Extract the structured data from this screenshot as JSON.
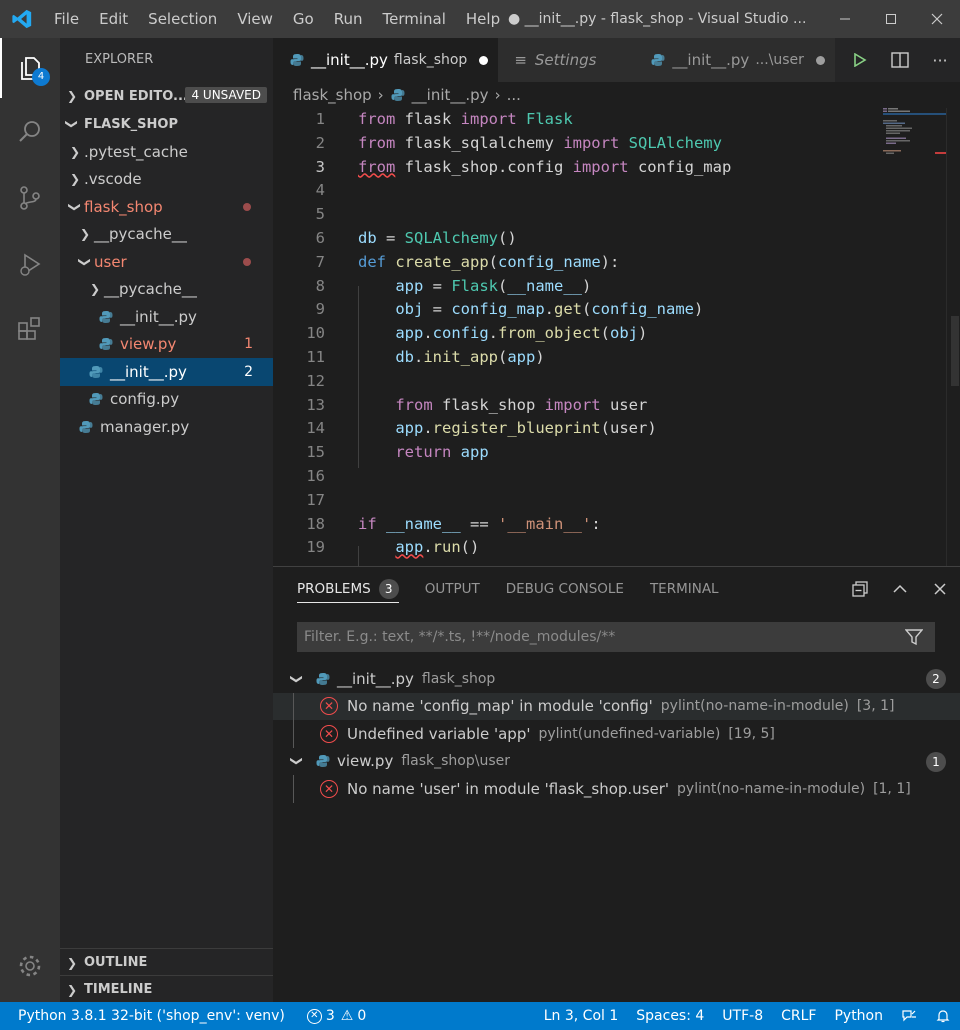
{
  "titlebar": {
    "menu": [
      "File",
      "Edit",
      "Selection",
      "View",
      "Go",
      "Run",
      "Terminal",
      "Help"
    ],
    "window_title": "● __init__.py - flask_shop - Visual Studio ..."
  },
  "activity": {
    "explorer_badge": "4"
  },
  "sidebar": {
    "title": "EXPLORER",
    "open_editors": "OPEN EDITO...",
    "unsaved": "4 UNSAVED",
    "root": "FLASK_SHOP",
    "items": [
      {
        "label": ".pytest_cache"
      },
      {
        "label": ".vscode"
      },
      {
        "label": "flask_shop"
      },
      {
        "label": "__pycache__"
      },
      {
        "label": "user"
      },
      {
        "label": "__pycache__"
      },
      {
        "label": "__init__.py"
      },
      {
        "label": "view.py",
        "count": "1"
      },
      {
        "label": "__init__.py",
        "count": "2"
      },
      {
        "label": "config.py"
      },
      {
        "label": "manager.py"
      }
    ],
    "outline": "OUTLINE",
    "timeline": "TIMELINE"
  },
  "tabs": [
    {
      "name": "__init__.py",
      "desc": "flask_shop"
    },
    {
      "name": "Settings"
    },
    {
      "name": "__init__.py",
      "desc": "...\\user"
    }
  ],
  "breadcrumb": [
    "flask_shop",
    "__init__.py",
    "..."
  ],
  "panel": {
    "tabs": [
      "PROBLEMS",
      "OUTPUT",
      "DEBUG CONSOLE",
      "TERMINAL"
    ],
    "problems_count": "3",
    "filter_placeholder": "Filter. E.g.: text, **/*.ts, !**/node_modules/**",
    "groups": [
      {
        "file": "__init__.py",
        "path": "flask_shop",
        "count": "2",
        "items": [
          {
            "msg": "No name 'config_map' in module 'config'",
            "src": "pylint(no-name-in-module)",
            "pos": "[3, 1]"
          },
          {
            "msg": "Undefined variable 'app'",
            "src": "pylint(undefined-variable)",
            "pos": "[19, 5]"
          }
        ]
      },
      {
        "file": "view.py",
        "path": "flask_shop\\user",
        "count": "1",
        "items": [
          {
            "msg": "No name 'user' in module 'flask_shop.user'",
            "src": "pylint(no-name-in-module)",
            "pos": "[1, 1]"
          }
        ]
      }
    ]
  },
  "statusbar": {
    "interpreter": "Python 3.8.1 32-bit ('shop_env': venv)",
    "errors": "3",
    "warnings": "0",
    "position": "Ln 3, Col 1",
    "spaces": "Spaces: 4",
    "encoding": "UTF-8",
    "eol": "CRLF",
    "language": "Python"
  },
  "colors": {
    "accent": "#007acc",
    "error": "#f14c4c",
    "modified": "#e2c08d"
  }
}
